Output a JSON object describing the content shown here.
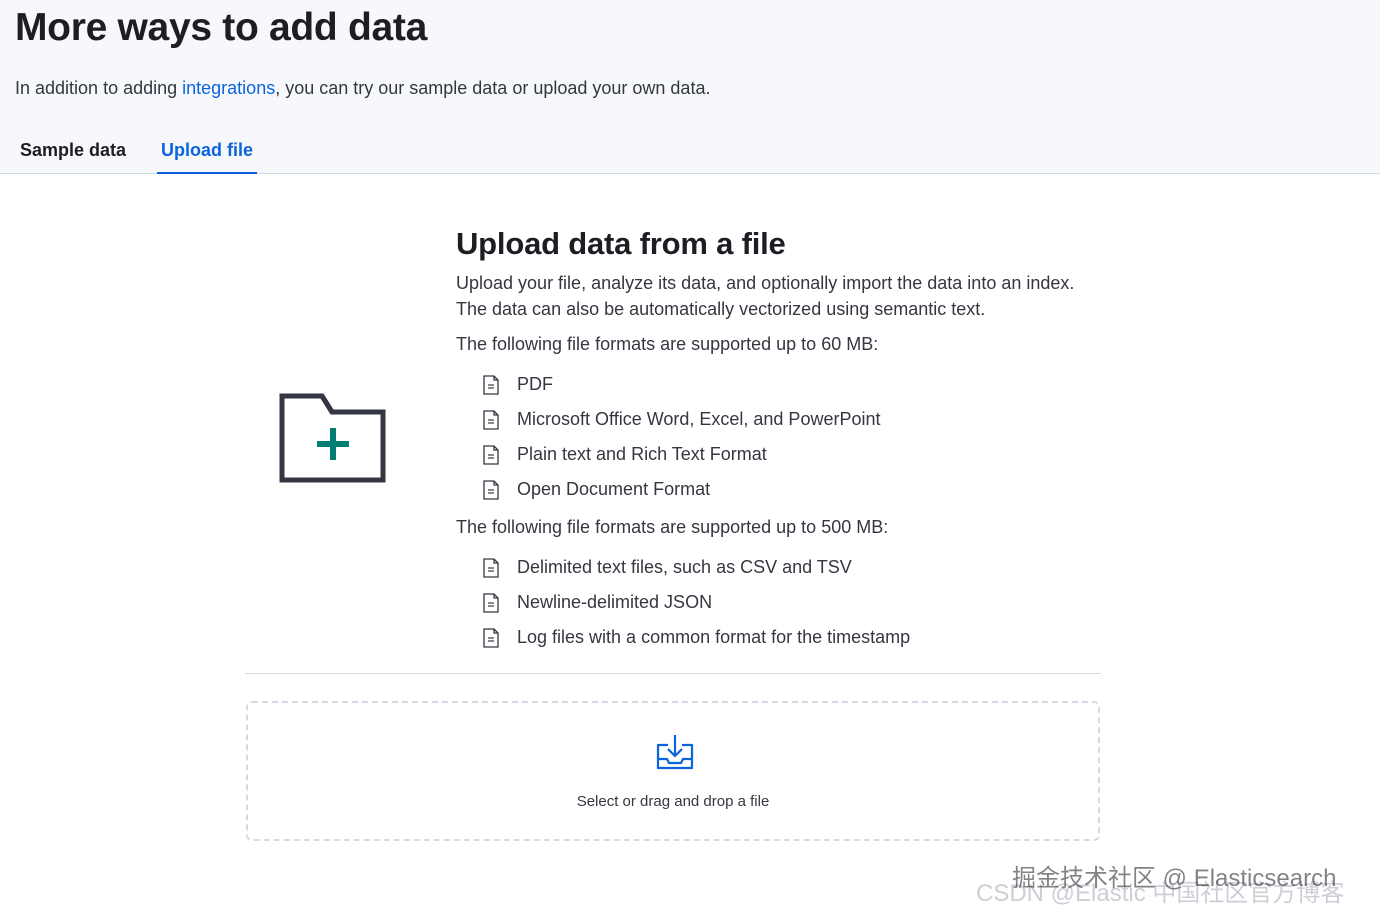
{
  "header": {
    "title": "More ways to add data",
    "subtitle_prefix": "In addition to adding ",
    "subtitle_link": "integrations",
    "subtitle_suffix": ", you can try our sample data or upload your own data."
  },
  "tabs": [
    {
      "label": "Sample data",
      "selected": false
    },
    {
      "label": "Upload file",
      "selected": true
    }
  ],
  "colors": {
    "accent": "#0b64dd",
    "folder_plus": "#017d73",
    "folder_outline": "#343741"
  },
  "upload": {
    "title": "Upload data from a file",
    "description_line1": "Upload your file, analyze its data, and optionally import the data into an index.",
    "description_line2": "The data can also be automatically vectorized using semantic text.",
    "formats_60_label": "The following file formats are supported up to 60 MB:",
    "formats_60": [
      "PDF",
      "Microsoft Office Word, Excel, and PowerPoint",
      "Plain text and Rich Text Format",
      "Open Document Format"
    ],
    "formats_500_label": "The following file formats are supported up to 500 MB:",
    "formats_500": [
      "Delimited text files, such as CSV and TSV",
      "Newline-delimited JSON",
      "Log files with a common format for the timestamp"
    ],
    "file_icon": "document-icon",
    "folder_icon": "folder-add-icon",
    "dropzone_icon": "download-tray-icon",
    "dropzone_text": "Select or drag and drop a file"
  },
  "watermark": {
    "line1": "掘金技术社区 @ Elasticsearch",
    "line2": "CSDN @Elastic 中国社区官方博客"
  }
}
